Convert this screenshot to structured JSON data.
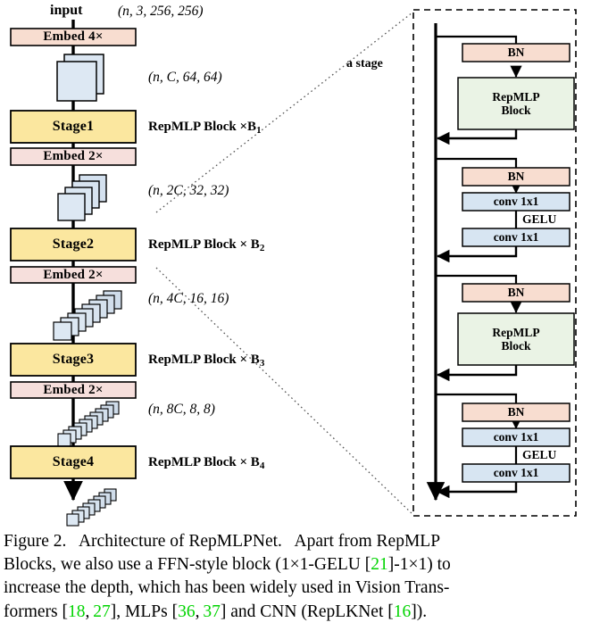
{
  "figure": {
    "caption_label": "Figure 2.",
    "caption_lines": [
      "Figure 2.   Architecture of RepMLPNet.   Apart from RepMLP",
      "Blocks, we also use a FFN-style block (1×1-GELU [21]-1×1) to",
      "increase the depth, which has been widely used in Vision Trans-",
      "formers [18, 27], MLPs [36, 37] and CNN (RepLKNet [16])."
    ],
    "caption_text": "Figure 2. Architecture of RepMLPNet. Apart from RepMLP Blocks, we also use a FFN-style block (1×1-GELU [21]-1×1) to increase the depth, which has been widely used in Vision Transformers [18, 27], MLPs [36, 37] and CNN (RepLKNet [16]).",
    "citations": [
      "21",
      "18",
      "27",
      "36",
      "37",
      "16"
    ]
  },
  "left_pipeline": {
    "input_label": "input",
    "input_shape": "(n, 3, 256, 256)",
    "nodes": [
      {
        "name": "embed1",
        "type": "embed",
        "label": "Embed 4×"
      },
      {
        "name": "tensor1",
        "type": "tensor",
        "shape": "(n, C, 64, 64)",
        "slices": 2
      },
      {
        "name": "stage1",
        "type": "stage",
        "label": "Stage1",
        "annotation": "RepMLP Block ×B",
        "annotation_sub": "1"
      },
      {
        "name": "embed2",
        "type": "embed",
        "label": "Embed 2×"
      },
      {
        "name": "tensor2",
        "type": "tensor",
        "shape": "(n, 2C, 32, 32)",
        "slices": 4
      },
      {
        "name": "stage2",
        "type": "stage",
        "label": "Stage2",
        "annotation": "RepMLP Block × B",
        "annotation_sub": "2"
      },
      {
        "name": "embed3",
        "type": "embed",
        "label": "Embed 2×"
      },
      {
        "name": "tensor3",
        "type": "tensor",
        "shape": "(n, 4C, 16, 16)",
        "slices": 8
      },
      {
        "name": "stage3",
        "type": "stage",
        "label": "Stage3",
        "annotation": "RepMLP Block × B",
        "annotation_sub": "3"
      },
      {
        "name": "embed4",
        "type": "embed",
        "label": "Embed 2×"
      },
      {
        "name": "tensor4",
        "type": "tensor",
        "shape": "(n, 8C, 8, 8)",
        "slices": 10
      },
      {
        "name": "stage4",
        "type": "stage",
        "label": "Stage4",
        "annotation": "RepMLP Block × B",
        "annotation_sub": "4"
      },
      {
        "name": "tensor5",
        "type": "tensor",
        "shape": "",
        "slices": 12
      }
    ]
  },
  "stage_detail": {
    "callout_label": "a stage",
    "blocks": [
      {
        "name": "bn-1",
        "label": "BN"
      },
      {
        "name": "repmlp-1",
        "label": "RepMLP\nBlock",
        "line1": "RepMLP",
        "line2": "Block"
      },
      {
        "name": "bn-2",
        "label": "BN"
      },
      {
        "name": "conv-1",
        "label": "conv 1x1"
      },
      {
        "name": "gelu-1",
        "label": "GELU"
      },
      {
        "name": "conv-2",
        "label": "conv 1x1"
      },
      {
        "name": "bn-3",
        "label": "BN"
      },
      {
        "name": "repmlp-2",
        "label": "RepMLP\nBlock",
        "line1": "RepMLP",
        "line2": "Block"
      },
      {
        "name": "bn-4",
        "label": "BN"
      },
      {
        "name": "conv-3",
        "label": "conv 1x1"
      },
      {
        "name": "gelu-2",
        "label": "GELU"
      },
      {
        "name": "conv-4",
        "label": "conv 1x1"
      }
    ]
  },
  "colors": {
    "embed_fill": "#f8ddd0",
    "stage_fill": "#fbe79f",
    "bn_fill": "#f8ddd0",
    "conv_fill": "#d7e5f2",
    "repmlp_fill": "#eaf3e5",
    "tensor_fill": "#dde8f3",
    "tensor_side": "#b9cbdb",
    "stroke": "#000000",
    "citation_green": "#00d400",
    "background": "#ffffff"
  }
}
